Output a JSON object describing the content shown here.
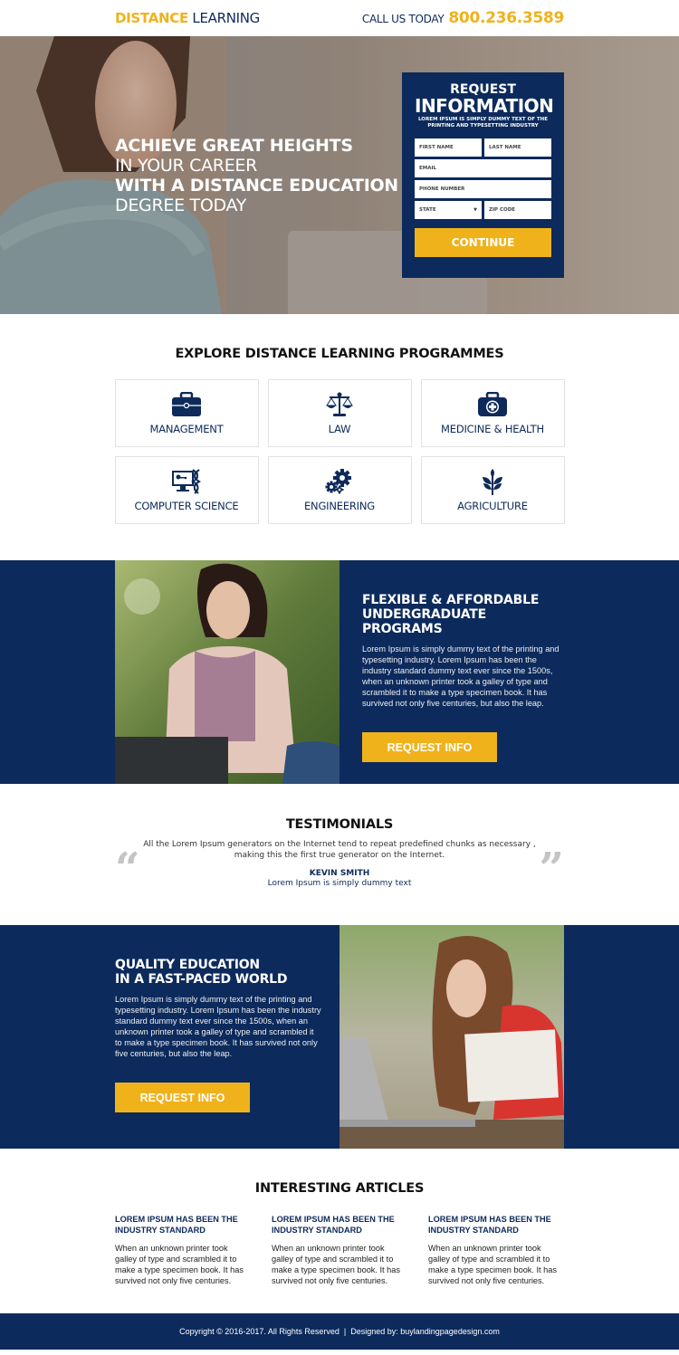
{
  "header": {
    "logo_part1": "DISTANCE",
    "logo_part2": "LEARNING",
    "call_label": "CALL US TODAY",
    "phone": "800.236.3589"
  },
  "hero": {
    "line1": "ACHIEVE GREAT HEIGHTS",
    "line2": "IN YOUR CAREER",
    "line3": "WITH A DISTANCE EDUCATION",
    "line4": "DEGREE TODAY"
  },
  "form": {
    "title1": "REQUEST",
    "title2": "INFORMATION",
    "subtitle": "LOREM IPSUM IS SIMPLY DUMMY TEXT OF THE PRINTING AND TYPESETTING INDUSTRY",
    "first_name_placeholder": "FIRST NAME",
    "last_name_placeholder": "LAST NAME",
    "email_placeholder": "EMAIL",
    "phone_placeholder": "PHONE NUMBER",
    "state_selected": "STATE",
    "zip_placeholder": "ZIP CODE",
    "submit_label": "CONTINUE"
  },
  "programmes": {
    "title": "EXPLORE DISTANCE LEARNING PROGRAMMES",
    "items": [
      {
        "label": "MANAGEMENT",
        "icon": "briefcase-icon"
      },
      {
        "label": "LAW",
        "icon": "scales-icon"
      },
      {
        "label": "MEDICINE & HEALTH",
        "icon": "medical-kit-icon"
      },
      {
        "label": "COMPUTER SCIENCE",
        "icon": "computer-dna-icon"
      },
      {
        "label": "ENGINEERING",
        "icon": "gears-icon"
      },
      {
        "label": "AGRICULTURE",
        "icon": "plant-icon"
      }
    ]
  },
  "feature1": {
    "title_line1": "FLEXIBLE & AFFORDABLE",
    "title_line2": "UNDERGRADUATE PROGRAMS",
    "body": "Lorem Ipsum is simply dummy text of the printing and typesetting industry. Lorem Ipsum has been the industry standard dummy text ever since the 1500s, when an unknown printer took a galley of type and scrambled it to make a type specimen book. It has survived not only five centuries, but also the leap.",
    "button_label": "REQUEST INFO"
  },
  "testimonials": {
    "title": "TESTIMONIALS",
    "quote_line1": "All the Lorem Ipsum generators on the Internet tend to repeat predefined chunks as necessary ,",
    "quote_line2": "making this the first true generator on the Internet.",
    "author": "KEVIN SMITH",
    "role": "Lorem Ipsum is simply dummy text",
    "open_quote": "“",
    "close_quote": "”"
  },
  "feature2": {
    "title_line1": "QUALITY EDUCATION",
    "title_line2": "IN A FAST-PACED WORLD",
    "body": "Lorem Ipsum is simply dummy text of the printing and typesetting industry. Lorem Ipsum has been the industry standard dummy text ever since the 1500s, when an unknown printer took a galley of type and scrambled it to make a type specimen book. It has survived not only five centuries, but also the leap.",
    "button_label": "REQUEST INFO"
  },
  "articles": {
    "title": "INTERESTING ARTICLES",
    "items": [
      {
        "title": "LOREM IPSUM HAS BEEN THE INDUSTRY STANDARD",
        "body": "When an unknown printer took galley of type and scrambled it to make a type specimen book. It has survived not only five centuries."
      },
      {
        "title": "LOREM IPSUM HAS BEEN THE INDUSTRY STANDARD",
        "body": "When an unknown printer took galley of type and scrambled it to make a type specimen book. It has survived not only five centuries."
      },
      {
        "title": "LOREM IPSUM HAS BEEN THE INDUSTRY STANDARD",
        "body": "When an unknown printer took galley of type and scrambled it to make a type specimen book. It has survived not only five centuries."
      }
    ]
  },
  "footer": {
    "text": "Copyright © 2016-2017. All Rights Reserved  |  Designed by: buylandingpagedesign.com"
  },
  "colors": {
    "navy": "#0c2a5c",
    "accent_yellow": "#f0b21b",
    "text_navy": "#0e2a5a"
  }
}
